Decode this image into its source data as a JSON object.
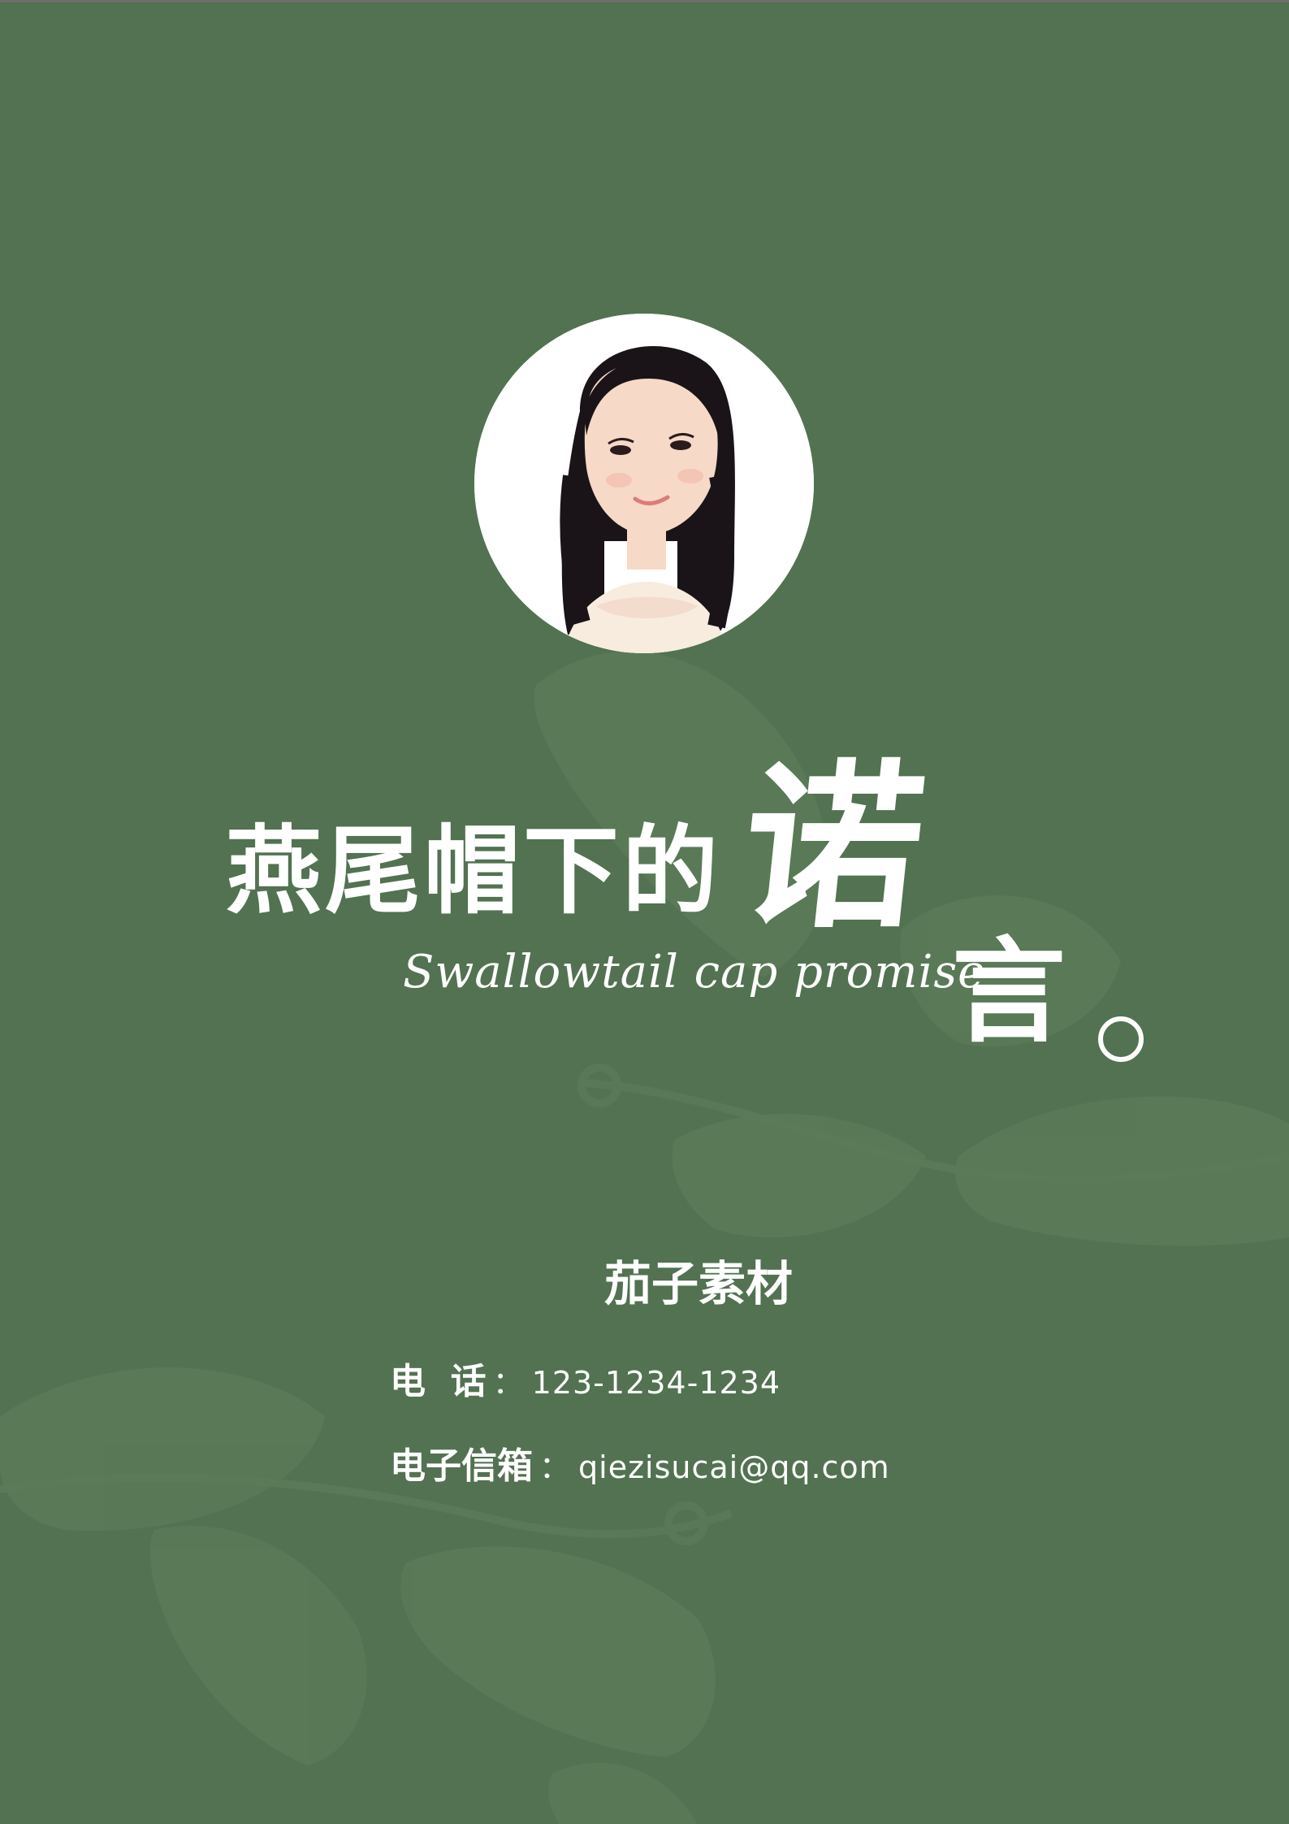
{
  "title": {
    "main": "燕尾帽下的",
    "big_char_1": "诺",
    "big_char_2": "言",
    "subtitle": "Swallowtail cap promise"
  },
  "company": "茄子素材",
  "contact": {
    "phone_label": "电  话",
    "phone_sep": "：",
    "phone_value": "123-1234-1234",
    "email_label": "电子信箱",
    "email_sep": "：",
    "email_value": "qiezisucai@qq.com"
  },
  "colors": {
    "background": "#527251",
    "text": "#ffffff"
  },
  "icons": {
    "avatar": "avatar-illustration",
    "decoration": "leaf-decoration"
  }
}
